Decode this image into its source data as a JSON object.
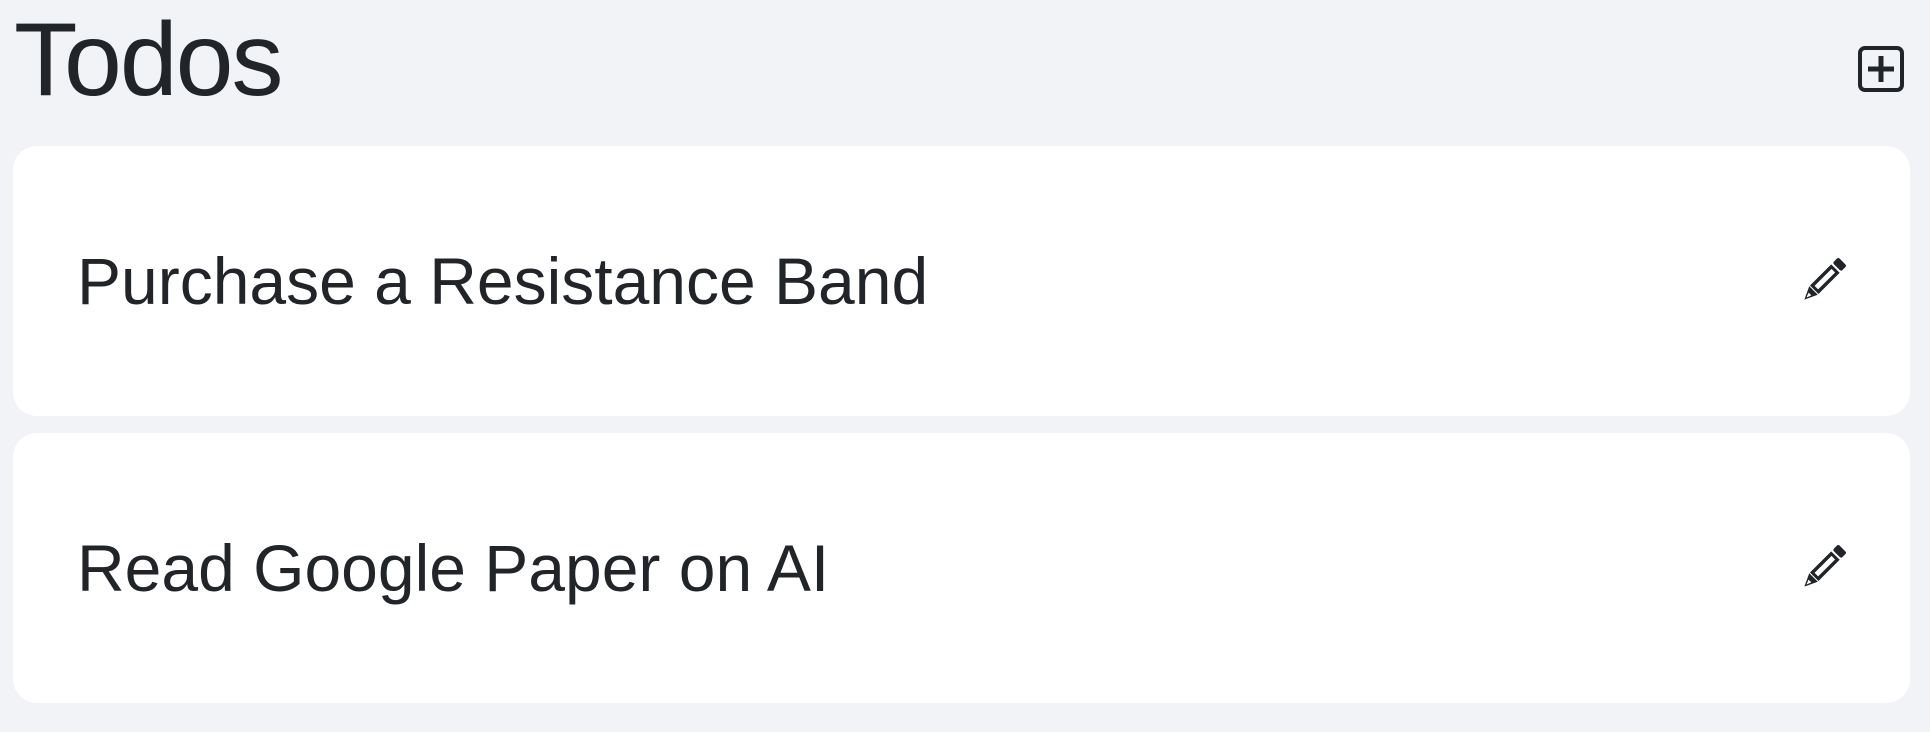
{
  "header": {
    "title": "Todos",
    "add_icon": "plus-square-icon"
  },
  "todos": [
    {
      "text": "Purchase a Resistance Band",
      "icon": "pencil-icon"
    },
    {
      "text": "Read Google Paper on AI",
      "icon": "pencil-icon"
    }
  ],
  "colors": {
    "background": "#f2f3f7",
    "card": "#ffffff",
    "text": "#212428"
  }
}
